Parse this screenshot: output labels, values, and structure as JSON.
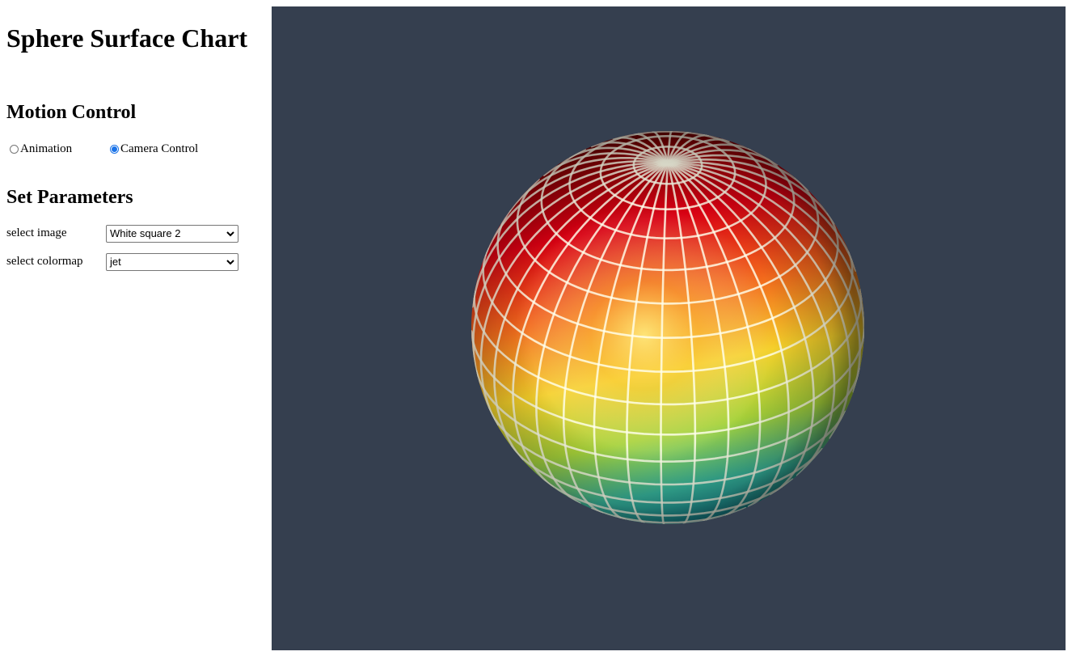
{
  "page": {
    "title": "Sphere Surface Chart"
  },
  "motion_control": {
    "heading": "Motion Control",
    "options": [
      {
        "label": "Animation",
        "selected": false
      },
      {
        "label": "Camera Control",
        "selected": true
      }
    ]
  },
  "parameters": {
    "heading": "Set Parameters",
    "image": {
      "label": "select image",
      "value": "White square 2"
    },
    "colormap": {
      "label": "select colormap",
      "value": "jet"
    }
  },
  "viewport": {
    "background": "#353f4f",
    "object": "sphere-surface",
    "colormap_stops": [
      "#7a0000",
      "#e00010",
      "#ff6a20",
      "#ffd030",
      "#b0d838",
      "#3cb89a",
      "#137a86"
    ],
    "grid_line_color": "#ffffff"
  }
}
